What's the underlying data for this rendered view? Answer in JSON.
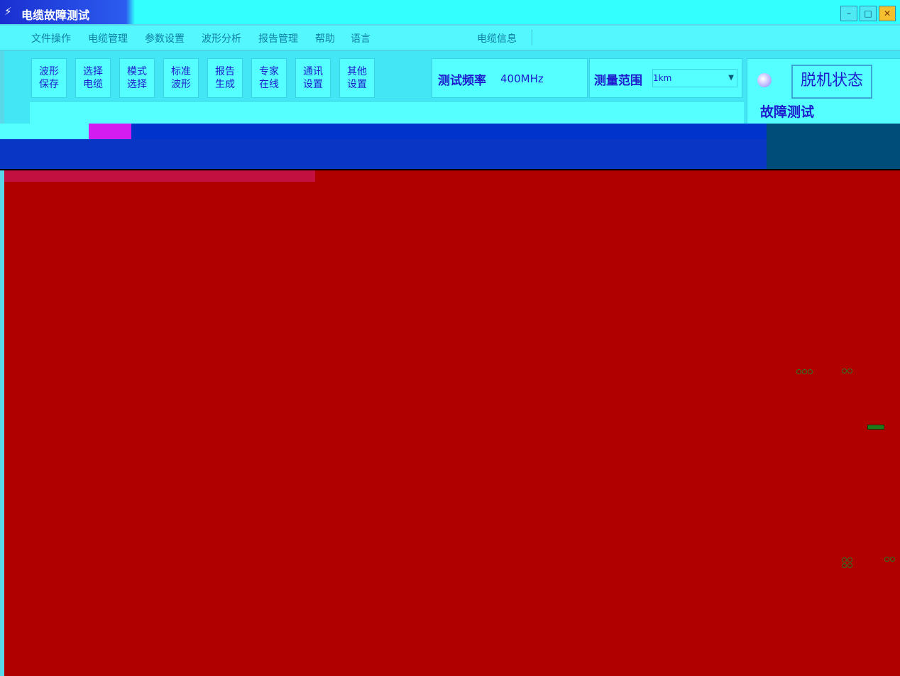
{
  "window": {
    "title": "电缆故障测试",
    "title_icon": "cable-tester-icon",
    "controls": [
      "minimize",
      "maximize",
      "close"
    ]
  },
  "menu": {
    "items": [
      "文件操作",
      "电缆管理",
      "参数设置",
      "波形分析",
      "报告管理",
      "帮助",
      "语言"
    ],
    "info_label": "电缆信息"
  },
  "toolbar": {
    "buttons": [
      "波形\n保存",
      "选择\n电缆",
      "模式\n选择",
      "标准\n波形",
      "报告\n生成",
      "专家\n在线",
      "通讯\n设置",
      "其他\n设置"
    ]
  },
  "frequency": {
    "label": "测试频率",
    "value": "400MHz"
  },
  "range": {
    "label": "测量范围",
    "value": "1km"
  },
  "status": {
    "label": "脱机状态",
    "mode_label": "故障测试"
  },
  "colors": {
    "accent": "#56ffff",
    "text": "#1c1ccc",
    "waveform_bg": "#b00000",
    "info_bar": "#0033cc"
  }
}
